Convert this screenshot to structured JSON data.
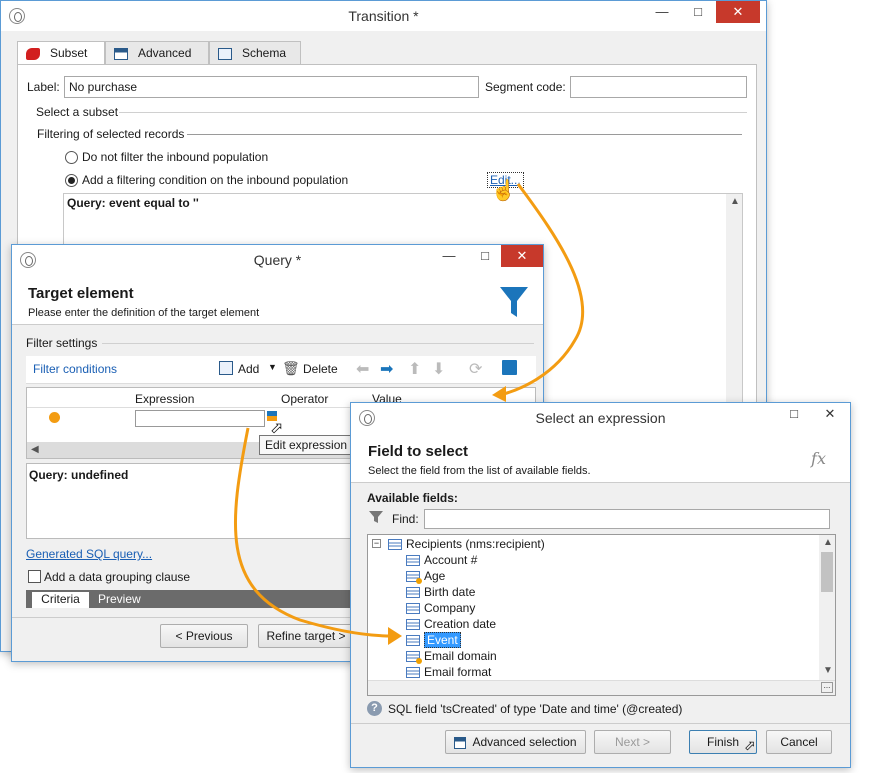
{
  "transition": {
    "title": "Transition *",
    "tabs": [
      "Subset",
      "Advanced",
      "Schema"
    ],
    "label_caption": "Label:",
    "label_value": "No purchase",
    "segment_caption": "Segment code:",
    "segment_value": "",
    "select_subset": "Select a subset",
    "filtering_caption": "Filtering of selected records",
    "radio_no_filter": "Do not filter the inbound population",
    "radio_add_filter": "Add a filtering condition on the inbound population",
    "edit_link": "Edit...",
    "query_text": "Query: event equal to ''"
  },
  "query": {
    "title": "Query *",
    "header_title": "Target element",
    "header_desc": "Please enter the definition of the target element",
    "filter_settings": "Filter settings",
    "filter_conditions": "Filter conditions",
    "add": "Add",
    "delete": "Delete",
    "col_expression": "Expression",
    "col_operator": "Operator",
    "col_value": "Value",
    "tooltip": "Edit expression",
    "query_text": "Query: undefined",
    "sql_link": "Generated SQL query...",
    "grouping": "Add a data grouping clause",
    "tab_criteria": "Criteria",
    "tab_preview": "Preview",
    "prev_btn": "< Previous",
    "refine_btn": "Refine target >"
  },
  "select_expr": {
    "title": "Select an expression",
    "header_title": "Field to select",
    "header_desc": "Select the field from the list of available fields.",
    "fx": "fx",
    "available": "Available fields:",
    "find": "Find:",
    "find_value": "",
    "root": "Recipients (nms:recipient)",
    "fields": [
      {
        "label": "Account #",
        "key": false
      },
      {
        "label": "Age",
        "key": true
      },
      {
        "label": "Birth date",
        "key": false
      },
      {
        "label": "Company",
        "key": false
      },
      {
        "label": "Creation date",
        "key": false
      },
      {
        "label": "Event",
        "key": false,
        "selected": true
      },
      {
        "label": "Email domain",
        "key": true
      },
      {
        "label": "Email format",
        "key": false
      }
    ],
    "sql_info": "SQL field 'tsCreated' of type 'Date and time' (@created)",
    "adv_btn": "Advanced selection",
    "next_btn": "Next >",
    "finish_btn": "Finish",
    "cancel_btn": "Cancel"
  },
  "colors": {
    "accent": "#f39c12",
    "link": "#1a5fb4",
    "selection": "#3399ff",
    "close": "#c7392b"
  }
}
